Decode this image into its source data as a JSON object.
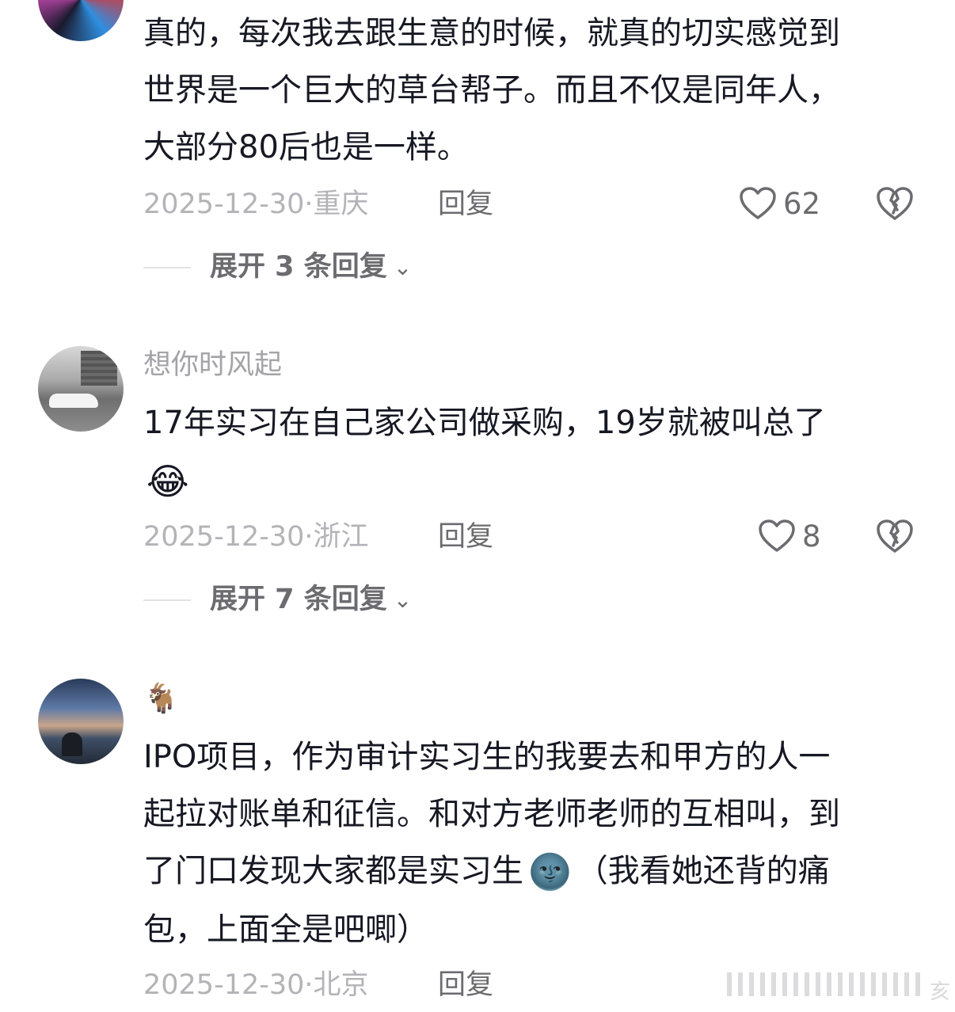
{
  "comments": [
    {
      "username": "",
      "text": "真的，每次我去跟生意的时候，就真的切实感觉到世界是一个巨大的草台帮子。而且不仅是同年人，大部分80后也是一样。",
      "lines": [
        "真的，每次我去跟生意的时候，就真的切实感觉到",
        "世界是一个巨大的草台帮子。而且不仅是同年人，",
        "大部分80后也是一样。"
      ],
      "date": "2025-12-30",
      "location": "重庆",
      "reply_label": "回复",
      "like_count": "62",
      "expand_label": "展开 3 条回复"
    },
    {
      "username": "想你时风起",
      "lines": [
        "17年实习在自己家公司做采购，19岁就被叫总了"
      ],
      "emoji": "😂",
      "date": "2025-12-30",
      "location": "浙江",
      "reply_label": "回复",
      "like_count": "8",
      "expand_label": "展开 7 条回复"
    },
    {
      "username": "🐐",
      "lines": [
        "IPO项目，作为审计实习生的我要去和甲方的人一",
        "起拉对账单和征信。和对方老师老师的互相叫，到",
        "了门口发现大家都是实习生",
        "（我看她还背的痛",
        "包，上面全是吧唧）"
      ],
      "emoji": "🌚",
      "date": "2025-12-30",
      "location": "北京",
      "reply_label": "回复"
    }
  ],
  "meta_separator": "·",
  "icons": {
    "like": "heart-outline-icon",
    "dislike": "broken-heart-icon",
    "expand": "chevron-down-icon"
  },
  "colors": {
    "text": "#161823",
    "secondary": "#a3a3a8",
    "action": "#6b6b70"
  },
  "watermark": {
    "text": "亥"
  }
}
